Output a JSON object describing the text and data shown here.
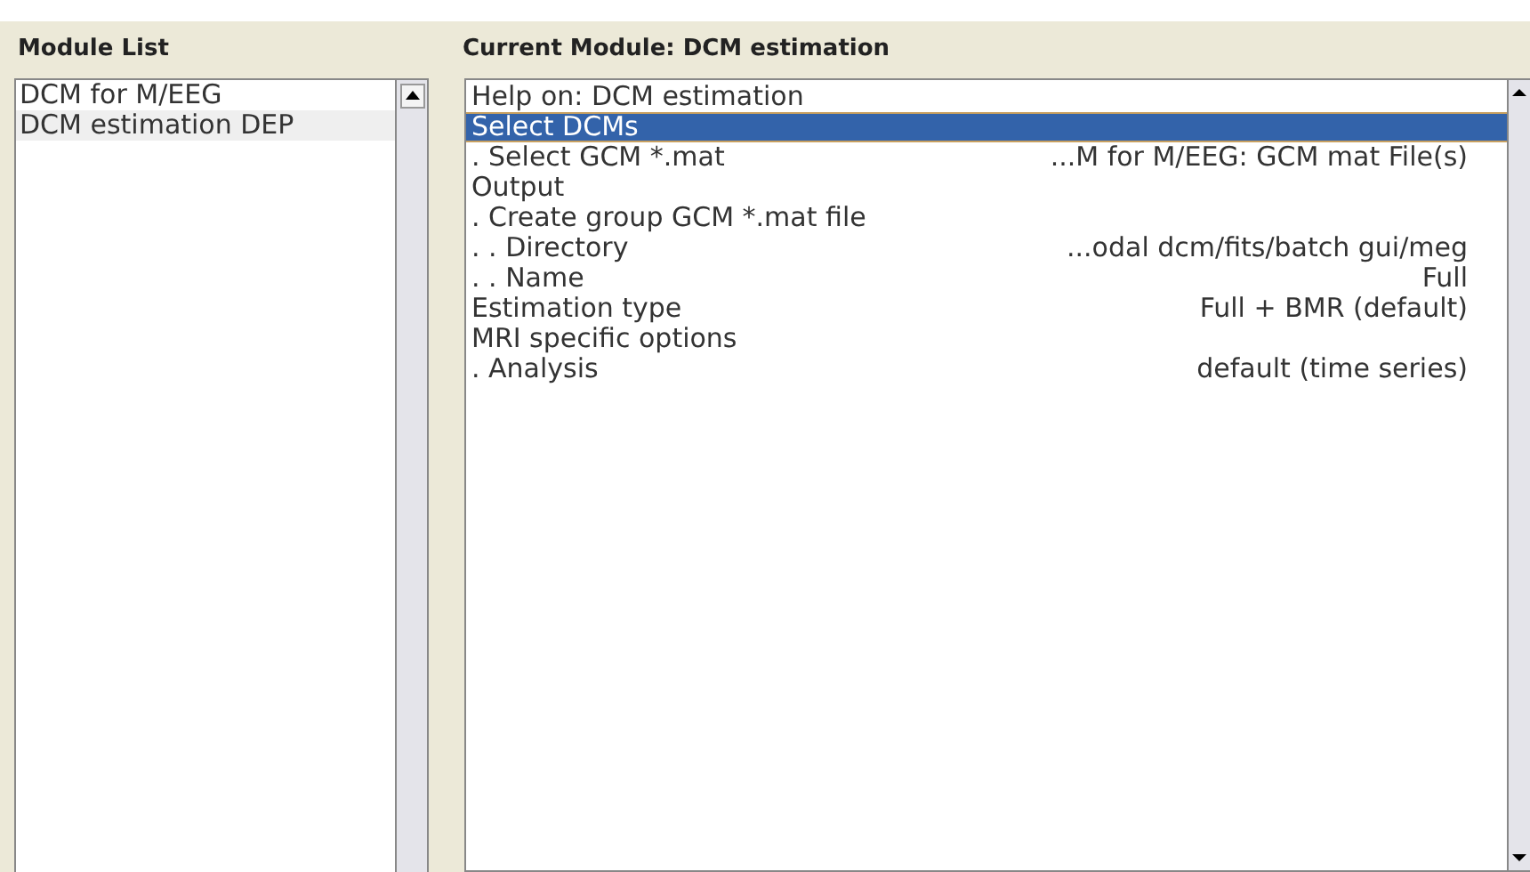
{
  "module_list": {
    "title": "Module List",
    "items": [
      {
        "label": "DCM for M/EEG",
        "selected": false
      },
      {
        "label": "DCM estimation DEP",
        "selected": true
      }
    ]
  },
  "current_module": {
    "title": "Current Module: DCM estimation",
    "rows": [
      {
        "label": "Help on: DCM estimation",
        "selected": false
      },
      {
        "label": "Select DCMs",
        "selected": true
      },
      {
        "label": ". Select GCM  *.mat",
        "value": "...M for M/EEG: GCM mat File(s)",
        "selected": false
      },
      {
        "label": "Output",
        "selected": false
      },
      {
        "label": ". Create group GCM  *.mat file",
        "selected": false
      },
      {
        "label": ". . Directory",
        "value": "...odal  dcm/fits/batch  gui/meg",
        "selected": false
      },
      {
        "label": ". . Name",
        "value": "Full",
        "selected": false
      },
      {
        "label": "Estimation type",
        "value": "Full + BMR (default)",
        "selected": false
      },
      {
        "label": "MRI specific options",
        "selected": false
      },
      {
        "label": ". Analysis",
        "value": "default (time series)",
        "selected": false
      }
    ]
  }
}
